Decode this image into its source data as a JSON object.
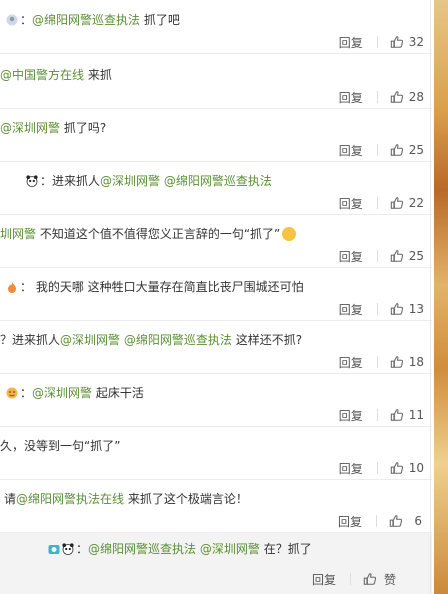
{
  "reply_label": "回复",
  "comments": [
    {
      "prefix": "：",
      "mentions": [
        "@绵阳网警巡查执法"
      ],
      "text": "抓了吧",
      "likes": "32"
    },
    {
      "prefix": "",
      "mentions": [
        "@中国警方在线"
      ],
      "text": "来抓",
      "likes": "28"
    },
    {
      "prefix": "",
      "mentions": [
        "@深圳网警"
      ],
      "text": "抓了吗?",
      "likes": "25"
    },
    {
      "prefix": "：进来抓人",
      "mentions": [
        "@深圳网警",
        "@绵阳网警巡查执法"
      ],
      "text": "",
      "likes": "22"
    },
    {
      "prefix": "",
      "mentions": [
        "圳网警"
      ],
      "text": "不知道这个值不值得您义正言辞的一句“抓了”",
      "likes": "25"
    },
    {
      "prefix": "：",
      "mentions": [],
      "text": "我的天哪 这种牲口大量存在简直比丧尸围城还可怕",
      "likes": "13"
    },
    {
      "prefix": "？进来抓人",
      "mentions": [
        "@深圳网警",
        "@绵阳网警巡查执法"
      ],
      "text": "这样还不抓?",
      "likes": "18"
    },
    {
      "prefix": "：",
      "mentions": [
        "@深圳网警"
      ],
      "text": "起床干活",
      "likes": "11"
    },
    {
      "prefix": "久，没等到一句“抓了”",
      "mentions": [],
      "text": "",
      "likes": "10"
    },
    {
      "prefix": "请",
      "mentions": [
        "@绵阳网警执法在线"
      ],
      "text": "来抓了这个极端言论！",
      "likes": "6"
    },
    {
      "prefix": "：",
      "mentions": [
        "@绵阳网警巡查执法",
        "@深圳网警"
      ],
      "text": "在？抓了",
      "likes": "赞"
    }
  ],
  "colors": {
    "mention": "#5b8f36",
    "accent_strip": "#d9a24e"
  },
  "icons": {
    "like": "thumbs-up-icon"
  }
}
